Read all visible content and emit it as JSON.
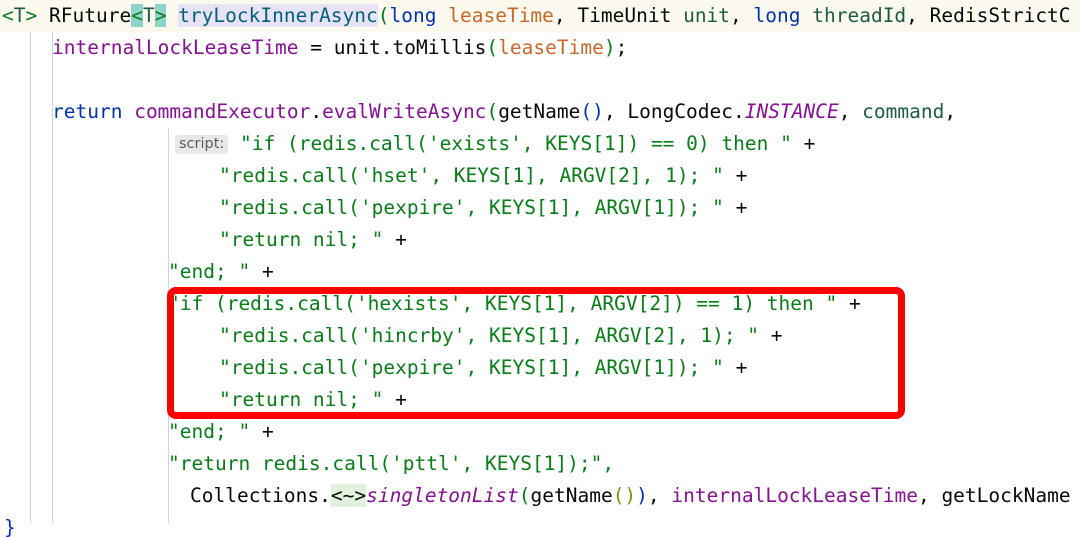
{
  "editor": {
    "language": "Java",
    "theme": "IntelliJ Light",
    "caret_line_background": "#fcfaef",
    "annotation_box_color": "#ff0000"
  },
  "hints": {
    "script_param": "script:"
  },
  "code": {
    "line1": {
      "generic_open": "<",
      "generic_T": "T",
      "generic_close": ">",
      "space1": " ",
      "return_type": "RFuture",
      "ret_gen_open": "<",
      "ret_gen_T": "T",
      "ret_gen_close": ">",
      "space2": " ",
      "method_name": "tryLockInnerAsync",
      "paren_open": "(",
      "kw_long_1": "long",
      "param_leaseTime": "leaseTime",
      "comma1": ", ",
      "type_TimeUnit": "TimeUnit",
      "param_unit": "unit",
      "comma2": ", ",
      "kw_long_2": "long",
      "param_threadId": "threadId",
      "comma3": ", ",
      "type_trailing": "RedisStrictC"
    },
    "line2": {
      "field": "internalLockLeaseTime",
      "eq": " = ",
      "obj": "unit",
      "dot": ".",
      "call": "toMillis",
      "paren_open": "(",
      "arg": "leaseTime",
      "paren_close": ")",
      "semi": ";"
    },
    "line4": {
      "kw_return": "return",
      "receiver": "commandExecutor",
      "dot1": ".",
      "method": "evalWriteAsync",
      "paren_open": "(",
      "arg1": "getName",
      "arg1_parens": "()",
      "comma1": ", ",
      "arg2_class": "LongCodec",
      "dot2": ".",
      "arg2_static": "INSTANCE",
      "comma2": ", ",
      "arg3": "command",
      "comma3": ","
    },
    "script_lines": [
      {
        "text": "\"if (redis.call('exists', KEYS[1]) == 0) then \"",
        "plus": "+",
        "indent": "hint",
        "in_box": false
      },
      {
        "text": "\"redis.call('hset', KEYS[1], ARGV[2], 1); \"",
        "plus": "+",
        "indent": "deep",
        "in_box": false
      },
      {
        "text": "\"redis.call('pexpire', KEYS[1], ARGV[1]); \"",
        "plus": "+",
        "indent": "deep",
        "in_box": false
      },
      {
        "text": "\"return nil; \"",
        "plus": "+",
        "indent": "deep",
        "in_box": false
      },
      {
        "text": "\"end; \"",
        "plus": "+",
        "indent": "shallow",
        "in_box": false
      },
      {
        "text": "\"if (redis.call('hexists', KEYS[1], ARGV[2]) == 1) then \"",
        "plus": "+",
        "indent": "shallow",
        "in_box": true
      },
      {
        "text": "\"redis.call('hincrby', KEYS[1], ARGV[2], 1); \"",
        "plus": "+",
        "indent": "deep",
        "in_box": true
      },
      {
        "text": "\"redis.call('pexpire', KEYS[1], ARGV[1]); \"",
        "plus": "+",
        "indent": "deep",
        "in_box": true
      },
      {
        "text": "\"return nil; \"",
        "plus": "+",
        "indent": "deep",
        "in_box": true
      },
      {
        "text": "\"end; \"",
        "plus": "+",
        "indent": "shallow",
        "in_box": false
      },
      {
        "text": "\"return redis.call('pttl', KEYS[1]);\",",
        "plus": "",
        "indent": "shallow",
        "in_box": false
      }
    ],
    "line_collections": {
      "class": "Collections",
      "dot": ".",
      "marker": "<~>",
      "method": "singletonList",
      "paren_open": "(",
      "inner_call": "getName",
      "inner_parens": "()",
      "paren_close": ")",
      "comma1": ", ",
      "arg_field": "internalLockLeaseTime",
      "comma2": ", ",
      "arg_trailing": "getLockName"
    },
    "line_close": {
      "brace": "}"
    }
  }
}
